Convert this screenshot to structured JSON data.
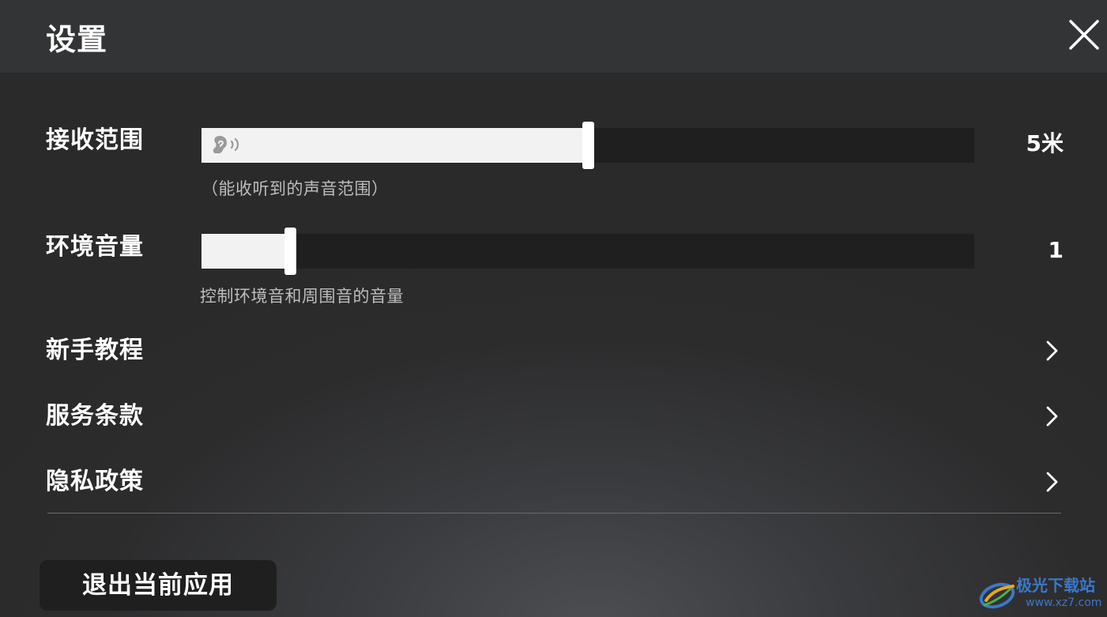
{
  "header": {
    "title": "设置"
  },
  "receive_range": {
    "label": "接收范围",
    "value_text": "5米",
    "fill_fraction": 0.5,
    "hint": "（能收听到的声音范围）"
  },
  "ambient_volume": {
    "label": "环境音量",
    "value_text": "1",
    "fill_fraction": 0.115,
    "hint": "控制环境音和周围音的音量"
  },
  "menu": [
    {
      "label": "新手教程"
    },
    {
      "label": "服务条款"
    },
    {
      "label": "隐私政策"
    }
  ],
  "exit_button": {
    "label": "退出当前应用"
  },
  "watermark": {
    "text": "极光下载站",
    "url": "www.xz7.com"
  },
  "icons": {
    "close": "close-icon",
    "ear": "ear-icon",
    "chevron": "chevron-right-icon"
  },
  "colors": {
    "track": "#1f1f1f",
    "fill": "#f2f2f2",
    "header": "#333435",
    "watermark": "#3a78c9"
  }
}
